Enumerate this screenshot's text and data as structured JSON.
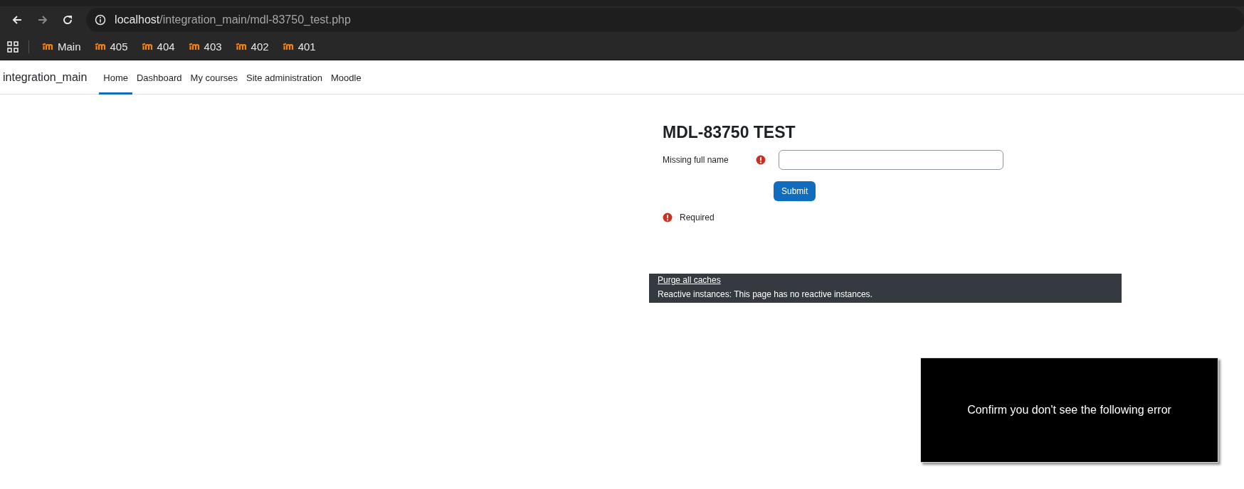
{
  "browser": {
    "url_host": "localhost",
    "url_path": "/integration_main/mdl-83750_test.php",
    "bookmarks": [
      {
        "label": "Main"
      },
      {
        "label": "405"
      },
      {
        "label": "404"
      },
      {
        "label": "403"
      },
      {
        "label": "402"
      },
      {
        "label": "401"
      }
    ]
  },
  "navbar": {
    "site_name": "integration_main",
    "items": [
      {
        "label": "Home",
        "selected": true
      },
      {
        "label": "Dashboard",
        "selected": false
      },
      {
        "label": "My courses",
        "selected": false
      },
      {
        "label": "Site administration",
        "selected": false
      },
      {
        "label": "Moodle",
        "selected": false
      }
    ]
  },
  "form": {
    "title": "MDL-83750 TEST",
    "field_label": "Missing full name",
    "field_required": true,
    "submit": "Submit",
    "required_note": "Required"
  },
  "footer": {
    "link": "Purge all caches",
    "text": "Reactive instances: This page has no reactive instances."
  },
  "notice": {
    "text": "Confirm you don't see the following error"
  }
}
